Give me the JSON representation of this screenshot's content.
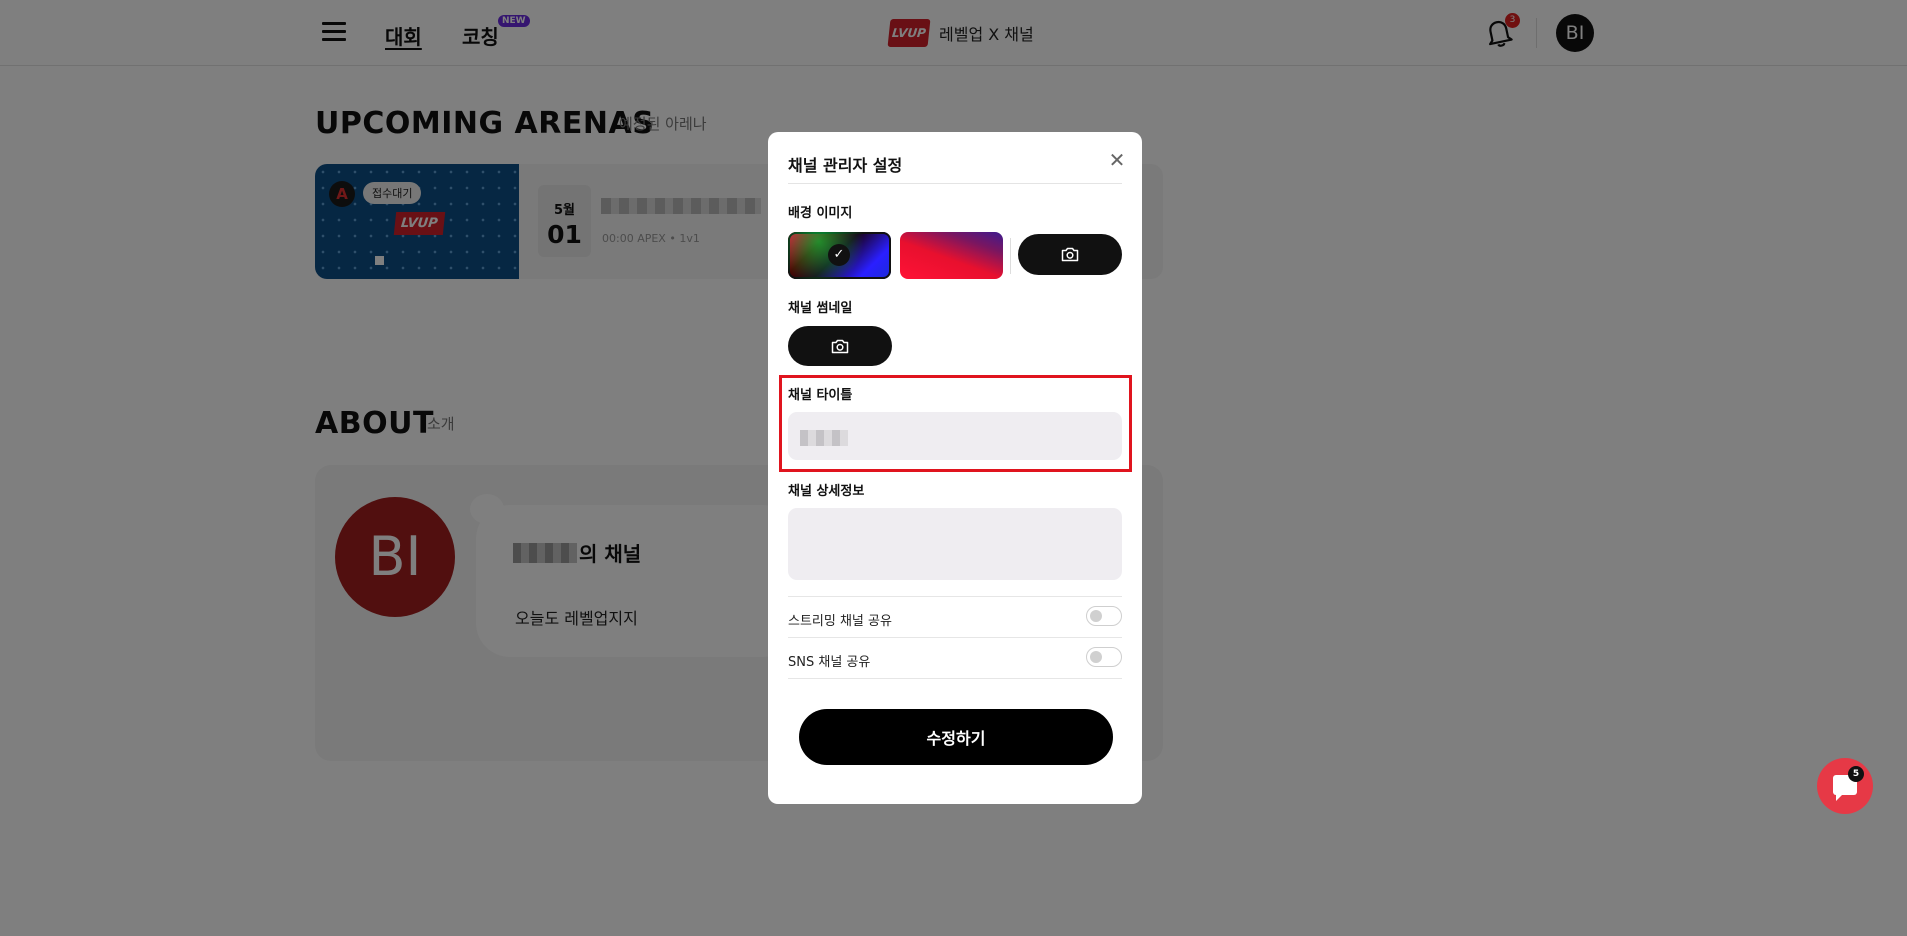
{
  "header": {
    "nav_tournament": "대회",
    "nav_coaching": "코칭",
    "new_badge": "NEW",
    "brand_logo_text": "LVUP",
    "brand_text": "레벨업 X 채널",
    "notification_count": "3",
    "avatar_initials": "BI"
  },
  "upcoming": {
    "title": "UPCOMING ARENAS",
    "subtitle": "예정된 아레나",
    "card": {
      "status_badge": "접수대기",
      "thumb_logo": "LVUP",
      "month": "5월",
      "day": "01",
      "meta": "00:00 APEX • 1v1"
    }
  },
  "about": {
    "title": "ABOUT",
    "subtitle": "소개",
    "avatar_initials": "BI",
    "channel_suffix": "의 채널",
    "description": "오늘도 레벨업지지"
  },
  "modal": {
    "title": "채널 관리자 설정",
    "bg_image_label": "배경 이미지",
    "thumbnail_label": "채널 썸네일",
    "channel_title_label": "채널 타이틀",
    "channel_detail_label": "채널 상세정보",
    "streaming_share_label": "스트리밍 채널 공유",
    "sns_share_label": "SNS 채널 공유",
    "submit_label": "수정하기",
    "streaming_share_enabled": false,
    "sns_share_enabled": false
  },
  "chat": {
    "unread_count": "5"
  },
  "colors": {
    "accent_red": "#e0141e",
    "brand_red": "#d3202a",
    "new_badge_purple": "#6a2be0",
    "chat_red": "#e63946"
  },
  "icons": [
    "hamburger-menu-icon",
    "bell-icon",
    "close-icon",
    "check-icon",
    "camera-icon",
    "chat-icon"
  ]
}
